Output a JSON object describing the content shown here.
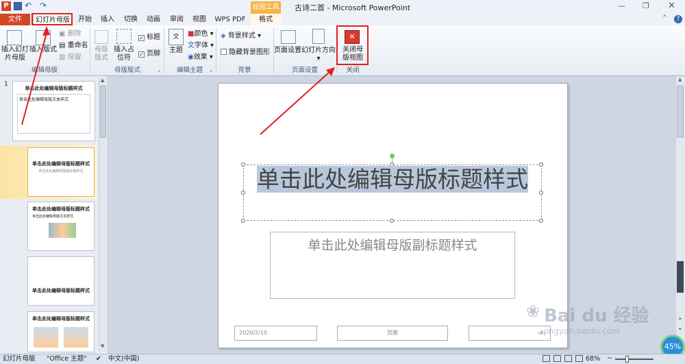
{
  "window": {
    "title": "古诗二首 - Microsoft PowerPoint",
    "context_tab": "绘图工具",
    "context_sub": "格式"
  },
  "tabs": [
    "文件",
    "幻灯片母版",
    "开始",
    "插入",
    "切换",
    "动画",
    "审阅",
    "视图",
    "WPS PDF"
  ],
  "ribbon": {
    "insert_master": "插入幻灯片母版",
    "insert_layout": "插入版式",
    "delete": "删除",
    "rename": "重命名",
    "preserve": "保留",
    "group_edit_master": "编辑母版",
    "master_layout": "母版版式",
    "insert_placeholder": "插入占位符",
    "title_cb": "标题",
    "footer_cb": "页脚",
    "group_master_layout": "母版版式",
    "theme": "主题",
    "colors": "颜色",
    "fonts": "字体",
    "effects": "效果",
    "group_edit_theme": "编辑主题",
    "bg_styles": "背景样式",
    "hide_bg": "隐藏背景图形",
    "group_bg": "背景",
    "page_setup": "页面设置",
    "orientation": "幻灯片方向",
    "group_page_setup": "页面设置",
    "close_master": "关闭母版视图",
    "group_close": "关闭"
  },
  "thumbs": [
    {
      "num": "1",
      "title": "单击此处编辑母版标题样式",
      "body": "单击此处编辑母版文本样式"
    },
    {
      "title": "单击此处编辑母版标题样式",
      "body": "单击此处编辑母版副标题样式"
    },
    {
      "title": "单击此处编辑母版标题样式",
      "body": "单击此处编辑母版文本样式"
    },
    {
      "title": "单击此处编辑母版标题样式",
      "body": ""
    },
    {
      "title": "单击此处编辑母版标题样式",
      "body": ""
    }
  ],
  "slide": {
    "title": "单击此处编辑母版标题样式",
    "subtitle": "单击此处编辑母版副标题样式",
    "date": "2020/2/10",
    "footer": "页脚",
    "num": "‹#›"
  },
  "status": {
    "view": "幻灯片母版",
    "theme": "\"Office 主题\"",
    "lang": "中文(中国)",
    "zoom": "68%",
    "badge": "45%"
  },
  "watermark": {
    "brand": "Bai du 经验",
    "url": "jingyan.baidu.com"
  }
}
